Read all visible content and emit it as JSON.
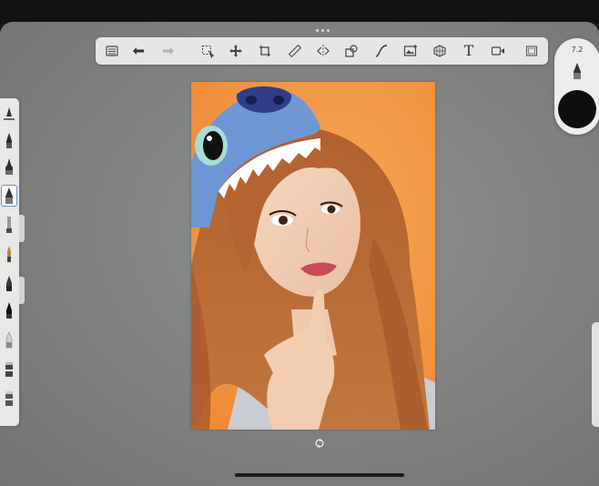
{
  "app": "painting-app",
  "toolbar": {
    "tools": [
      {
        "name": "gallery",
        "icon": "gallery-icon"
      },
      {
        "name": "undo",
        "icon": "undo-icon"
      },
      {
        "name": "redo",
        "icon": "redo-icon"
      },
      {
        "name": "selection",
        "icon": "selection-icon"
      },
      {
        "name": "transform",
        "icon": "transform-icon"
      },
      {
        "name": "crop",
        "icon": "crop-icon"
      },
      {
        "name": "ruler",
        "icon": "ruler-icon"
      },
      {
        "name": "symmetry",
        "icon": "symmetry-icon"
      },
      {
        "name": "shapes",
        "icon": "shapes-icon"
      },
      {
        "name": "stroke",
        "icon": "curve-icon"
      },
      {
        "name": "image",
        "icon": "image-icon"
      },
      {
        "name": "perspective",
        "icon": "perspective-icon"
      },
      {
        "name": "text",
        "icon": "text-icon"
      },
      {
        "name": "timelapse",
        "icon": "video-icon"
      },
      {
        "name": "layers",
        "icon": "layers-icon"
      }
    ],
    "text_tool_label": "T"
  },
  "right_puck": {
    "brush_size": "7.2",
    "color": "#0f0f12"
  },
  "canvas": {
    "background_color": "#f0923f"
  },
  "colors": {
    "toolbar_bg": "#e6e6e4",
    "screen_bg": "#8a8c8a",
    "selection_outline": "#6b8ec7"
  }
}
